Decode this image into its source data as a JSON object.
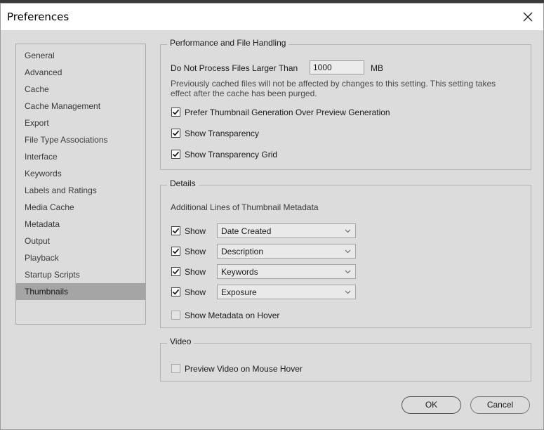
{
  "window": {
    "title": "Preferences"
  },
  "sidebar": {
    "items": [
      {
        "label": "General",
        "selected": false
      },
      {
        "label": "Advanced",
        "selected": false
      },
      {
        "label": "Cache",
        "selected": false
      },
      {
        "label": "Cache Management",
        "selected": false
      },
      {
        "label": "Export",
        "selected": false
      },
      {
        "label": "File Type Associations",
        "selected": false
      },
      {
        "label": "Interface",
        "selected": false
      },
      {
        "label": "Keywords",
        "selected": false
      },
      {
        "label": "Labels and Ratings",
        "selected": false
      },
      {
        "label": "Media Cache",
        "selected": false
      },
      {
        "label": "Metadata",
        "selected": false
      },
      {
        "label": "Output",
        "selected": false
      },
      {
        "label": "Playback",
        "selected": false
      },
      {
        "label": "Startup Scripts",
        "selected": false
      },
      {
        "label": "Thumbnails",
        "selected": true
      }
    ]
  },
  "performance": {
    "title": "Performance and File Handling",
    "max_size_label": "Do Not Process Files Larger Than",
    "max_size_value": "1000",
    "max_size_unit": "MB",
    "note": "Previously cached files will not be affected by changes to this setting. This setting takes effect after the cache has been purged.",
    "options": [
      {
        "label": "Prefer Thumbnail Generation Over Preview Generation",
        "checked": true
      },
      {
        "label": "Show Transparency",
        "checked": true
      },
      {
        "label": "Show Transparency Grid",
        "checked": true
      }
    ]
  },
  "details": {
    "title": "Details",
    "lines_label": "Additional Lines of Thumbnail Metadata",
    "rows": [
      {
        "show_label": "Show",
        "checked": true,
        "value": "Date Created"
      },
      {
        "show_label": "Show",
        "checked": true,
        "value": "Description"
      },
      {
        "show_label": "Show",
        "checked": true,
        "value": "Keywords"
      },
      {
        "show_label": "Show",
        "checked": true,
        "value": "Exposure"
      }
    ],
    "hover_label": "Show Metadata on Hover",
    "hover_checked": false
  },
  "video": {
    "title": "Video",
    "preview_label": "Preview Video on Mouse Hover",
    "preview_checked": false
  },
  "buttons": {
    "ok": "OK",
    "cancel": "Cancel"
  }
}
